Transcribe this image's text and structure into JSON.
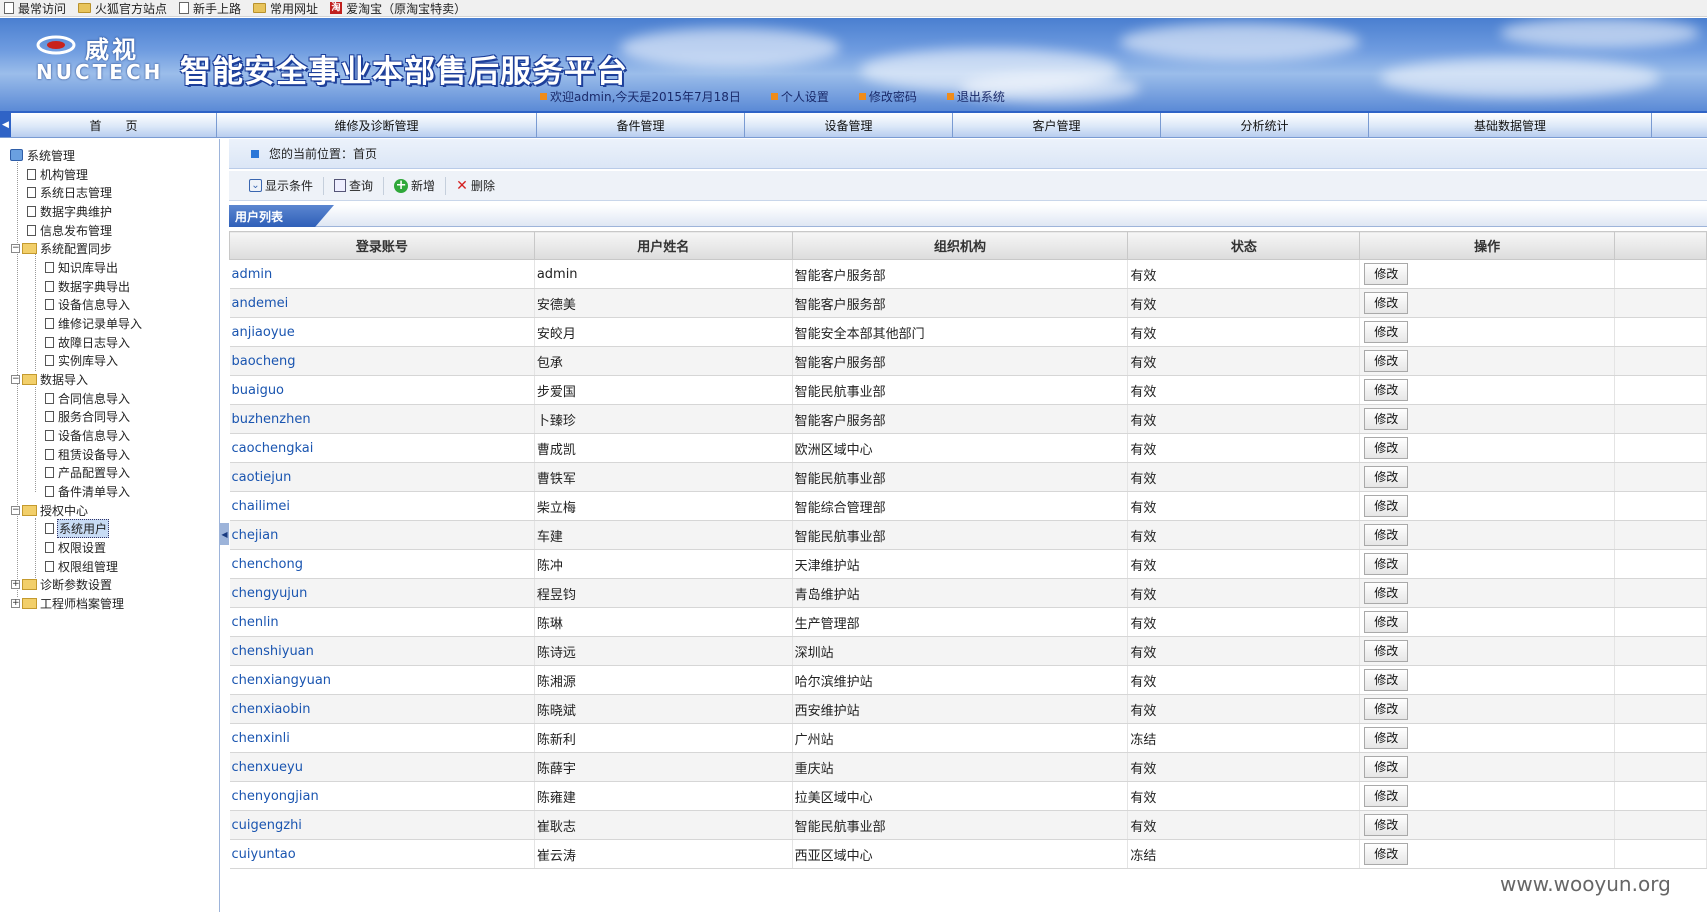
{
  "bookmarks": [
    {
      "icon": "page-icon",
      "label": "最常访问"
    },
    {
      "icon": "folder-icon",
      "label": "火狐官方站点"
    },
    {
      "icon": "page-icon",
      "label": "新手上路"
    },
    {
      "icon": "folder-icon",
      "label": "常用网址"
    },
    {
      "icon": "taobao-icon",
      "label": "爱淘宝（原淘宝特卖）"
    }
  ],
  "header": {
    "logo_cn": "威视",
    "logo_en": "NUCTECH",
    "title": "智能安全事业本部售后服务平台",
    "welcome": "欢迎admin,今天是2015年7月18日",
    "personal_settings": "个人设置",
    "change_password": "修改密码",
    "logout": "退出系统",
    "brand_color": "#2f63c6"
  },
  "nav": [
    "首　　页",
    "维修及诊断管理",
    "备件管理",
    "设备管理",
    "客户管理",
    "分析统计",
    "基础数据管理"
  ],
  "sidebar": {
    "root": "系统管理",
    "items": [
      "机构管理",
      "系统日志管理",
      "数据字典维护",
      "信息发布管理",
      "系统配置同步",
      "知识库导出",
      "数据字典导出",
      "设备信息导入",
      "维修记录单导入",
      "故障日志导入",
      "实例库导入",
      "数据导入",
      "合同信息导入",
      "服务合同导入",
      "设备信息导入",
      "租赁设备导入",
      "产品配置导入",
      "备件清单导入",
      "授权中心",
      "系统用户",
      "权限设置",
      "权限组管理",
      "诊断参数设置",
      "工程师档案管理"
    ],
    "expand_minus": "−",
    "expand_plus": "+"
  },
  "breadcrumb": "您的当前位置：首页",
  "toolbar": {
    "show_conditions": "显示条件",
    "query": "查询",
    "add": "新增",
    "delete": "删除"
  },
  "list": {
    "title": "用户列表",
    "headers": [
      "登录账号",
      "用户姓名",
      "组织机构",
      "状态",
      "操作"
    ],
    "edit_label": "修改",
    "rows": [
      [
        "admin",
        "admin",
        "智能客户服务部",
        "有效"
      ],
      [
        "andemei",
        "安德美",
        "智能客户服务部",
        "有效"
      ],
      [
        "anjiaoyue",
        "安皎月",
        "智能安全本部其他部门",
        "有效"
      ],
      [
        "baocheng",
        "包承",
        "智能客户服务部",
        "有效"
      ],
      [
        "buaiguo",
        "步爱国",
        "智能民航事业部",
        "有效"
      ],
      [
        "buzhenzhen",
        "卜臻珍",
        "智能客户服务部",
        "有效"
      ],
      [
        "caochengkai",
        "曹成凯",
        "欧洲区域中心",
        "有效"
      ],
      [
        "caotiejun",
        "曹铁军",
        "智能民航事业部",
        "有效"
      ],
      [
        "chailimei",
        "柴立梅",
        "智能综合管理部",
        "有效"
      ],
      [
        "chejian",
        "车建",
        "智能民航事业部",
        "有效"
      ],
      [
        "chenchong",
        "陈冲",
        "天津维护站",
        "有效"
      ],
      [
        "chengyujun",
        "程昱钧",
        "青岛维护站",
        "有效"
      ],
      [
        "chenlin",
        "陈琳",
        "生产管理部",
        "有效"
      ],
      [
        "chenshiyuan",
        "陈诗远",
        "深圳站",
        "有效"
      ],
      [
        "chenxiangyuan",
        "陈湘源",
        "哈尔滨维护站",
        "有效"
      ],
      [
        "chenxiaobin",
        "陈晓斌",
        "西安维护站",
        "有效"
      ],
      [
        "chenxinli",
        "陈新利",
        "广州站",
        "冻结"
      ],
      [
        "chenxueyu",
        "陈薛宇",
        "重庆站",
        "有效"
      ],
      [
        "chenyongjian",
        "陈雍建",
        "拉美区域中心",
        "有效"
      ],
      [
        "cuigengzhi",
        "崔耿志",
        "智能民航事业部",
        "有效"
      ],
      [
        "cuiyuntao",
        "崔云涛",
        "西亚区域中心",
        "冻结"
      ]
    ]
  },
  "watermark": "www.wooyun.org"
}
